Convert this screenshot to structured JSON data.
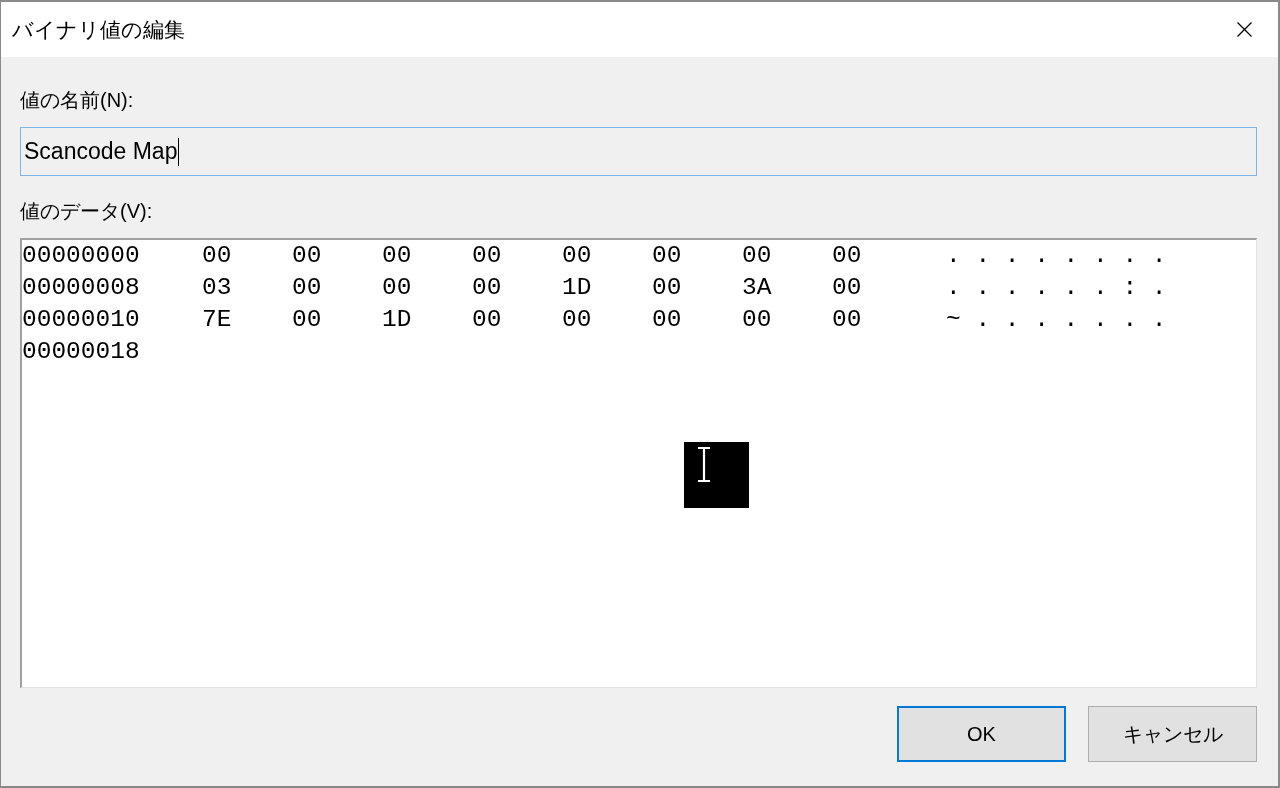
{
  "window": {
    "title": "バイナリ値の編集"
  },
  "value_name": {
    "label": "値の名前(N):",
    "value": "Scancode Map",
    "read_only": true,
    "focused": true
  },
  "value_data": {
    "label": "値のデータ(V):",
    "rows": [
      {
        "address": "00000000",
        "bytes": [
          "00",
          "00",
          "00",
          "00",
          "00",
          "00",
          "00",
          "00"
        ],
        "ascii": "........"
      },
      {
        "address": "00000008",
        "bytes": [
          "03",
          "00",
          "00",
          "00",
          "1D",
          "00",
          "3A",
          "00"
        ],
        "ascii": "......:."
      },
      {
        "address": "00000010",
        "bytes": [
          "7E",
          "00",
          "1D",
          "00",
          "00",
          "00",
          "00",
          "00"
        ],
        "ascii": "~......."
      },
      {
        "address": "00000018"
      }
    ]
  },
  "buttons": [
    {
      "label": "OK",
      "default": true
    },
    {
      "label": "キャンセル",
      "default": false
    }
  ]
}
